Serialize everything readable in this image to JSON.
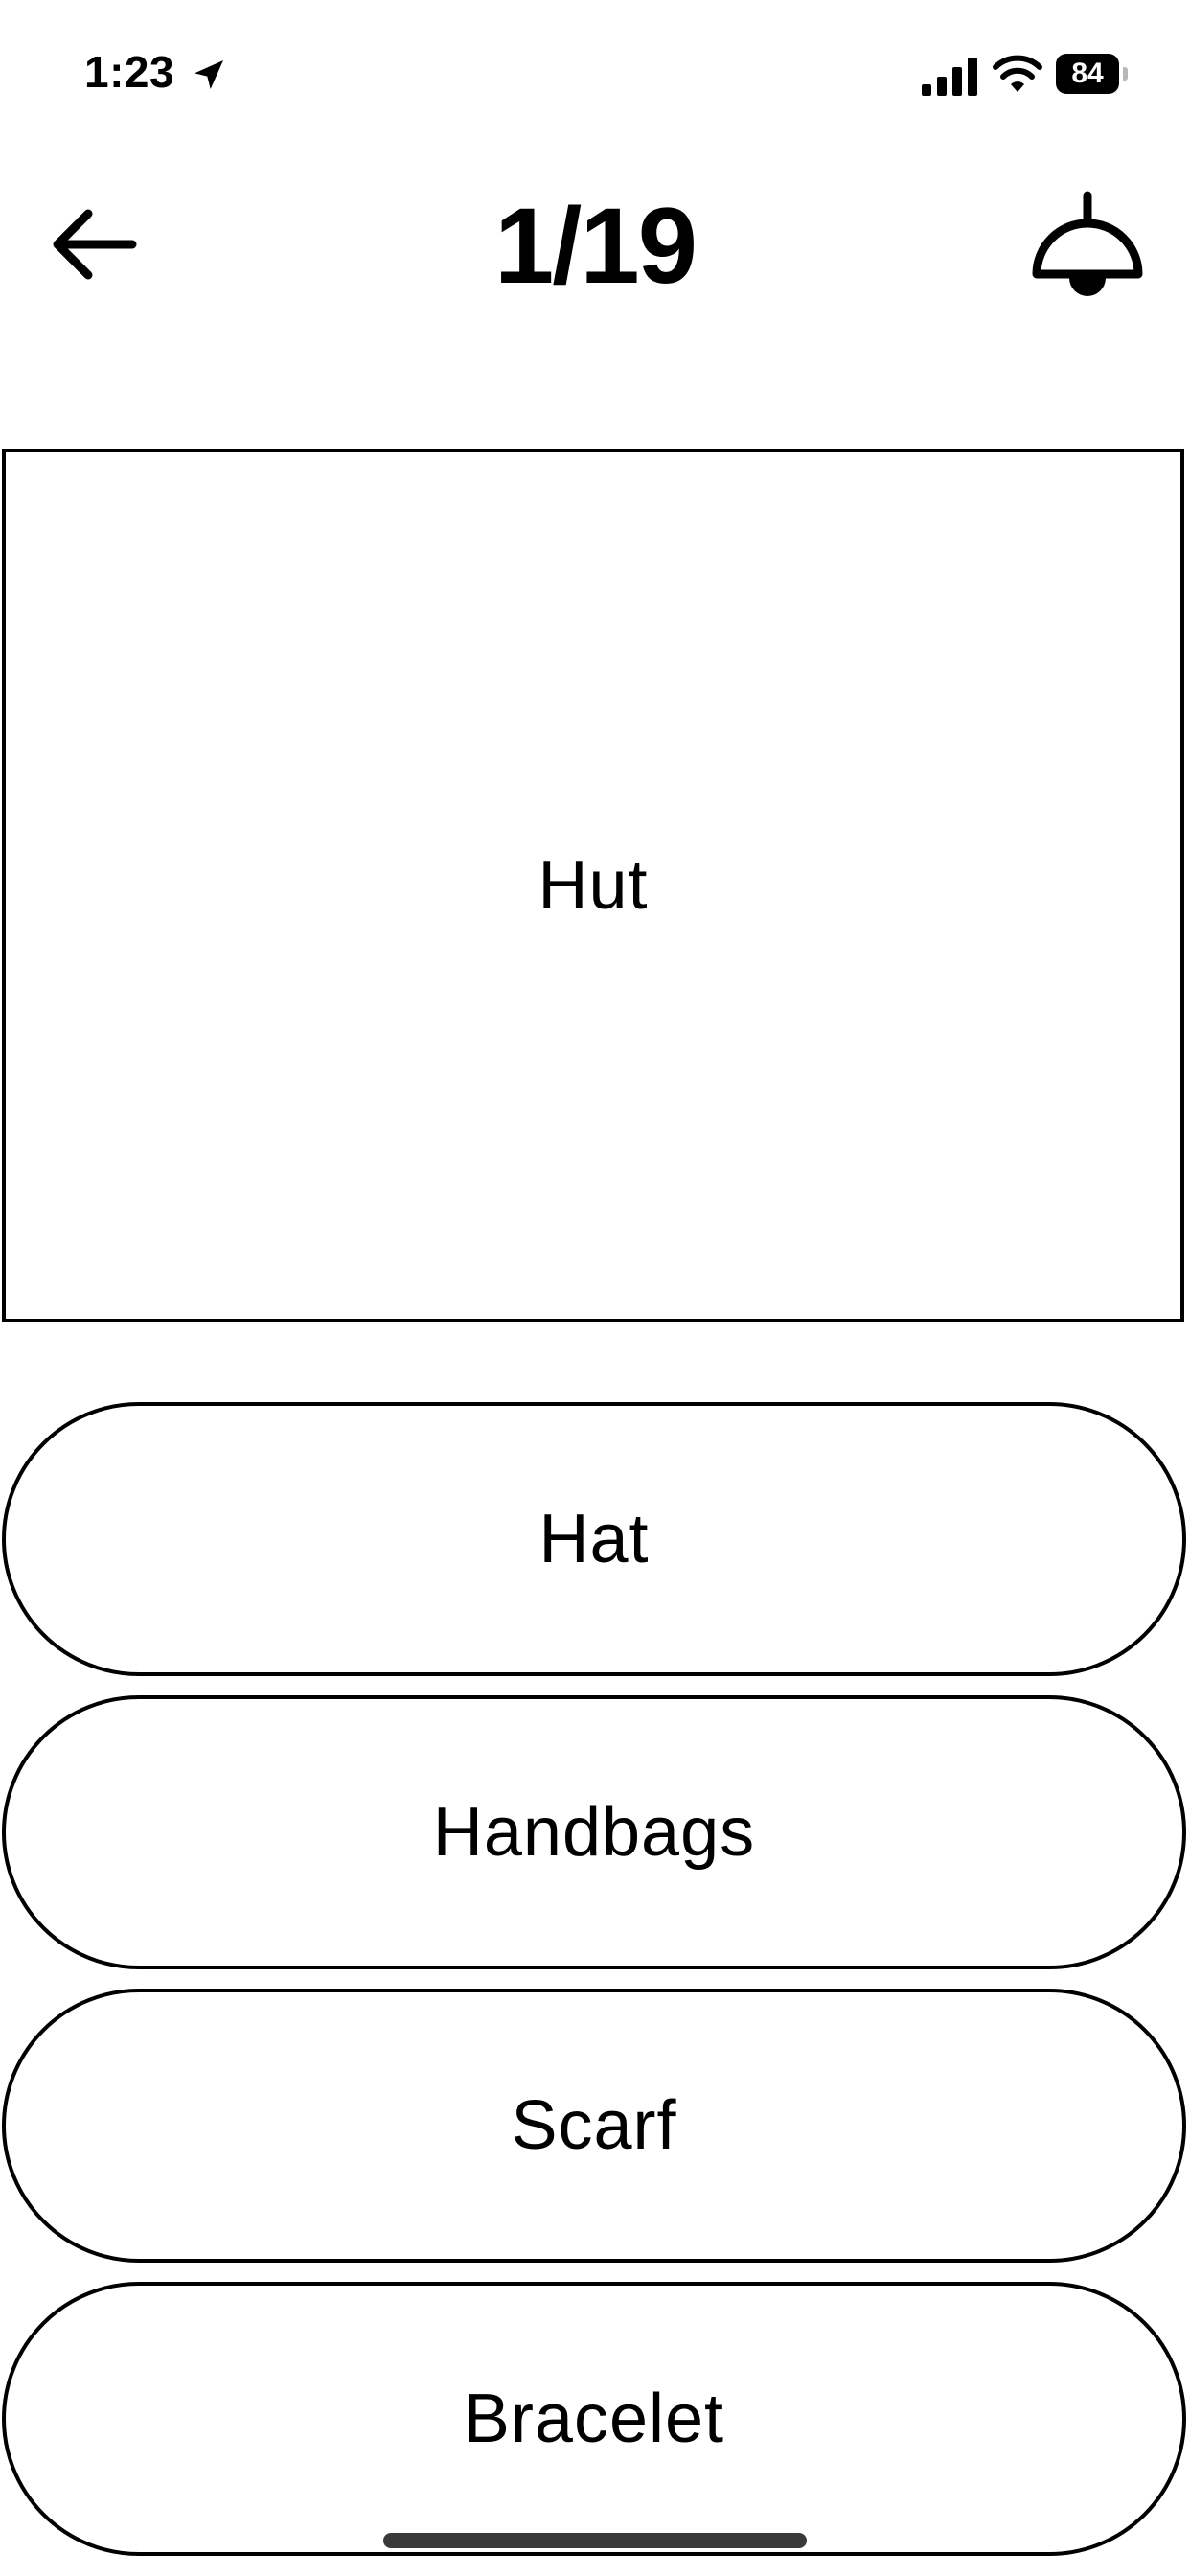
{
  "status_bar": {
    "time": "1:23",
    "battery": "84",
    "icons": [
      "location-arrow-icon",
      "cellular-signal-icon",
      "wifi-icon",
      "battery-icon"
    ]
  },
  "header": {
    "progress": "1/19",
    "back_icon": "arrow-left-icon",
    "hint_icon": "ceiling-lamp-icon"
  },
  "question": {
    "word": "Hut"
  },
  "answers": [
    {
      "label": "Hat"
    },
    {
      "label": "Handbags"
    },
    {
      "label": "Scarf"
    },
    {
      "label": "Bracelet"
    }
  ],
  "colors": {
    "background": "#ffffff",
    "foreground": "#000000"
  }
}
